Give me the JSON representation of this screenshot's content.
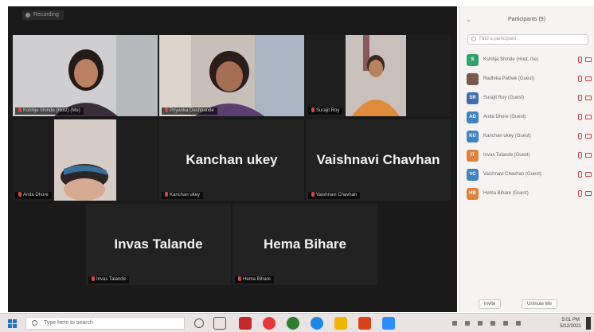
{
  "meeting": {
    "recording_label": "Recording",
    "tiles": [
      {
        "id": "t1",
        "overlay_name": "Kshitija Shinde (Host) (Me)",
        "big_name": ""
      },
      {
        "id": "t2",
        "overlay_name": "Priyanka Deshpande",
        "big_name": ""
      },
      {
        "id": "t3",
        "overlay_name": "Surajit Roy",
        "big_name": ""
      },
      {
        "id": "t4",
        "overlay_name": "Anita Dhore",
        "big_name": ""
      },
      {
        "id": "t5",
        "overlay_name": "Kanchan ukey",
        "big_name": "Kanchan ukey"
      },
      {
        "id": "t6",
        "overlay_name": "Vaishnavi Chavhan",
        "big_name": "Vaishnavi Chavhan"
      },
      {
        "id": "t7",
        "overlay_name": "Invas Talande",
        "big_name": "Invas Talande"
      },
      {
        "id": "t8",
        "overlay_name": "Hema Bihare",
        "big_name": "Hema Bihare"
      }
    ]
  },
  "participants_panel": {
    "title": "Participants (9)",
    "search_placeholder": "Find a participant",
    "items": [
      {
        "initials": "S",
        "color": "#2fa36b",
        "name": "Kshitija Shinde (Host, me)"
      },
      {
        "initials": "",
        "color": "#7a5a48",
        "name": "Radhika Pathak (Guest)"
      },
      {
        "initials": "SR",
        "color": "#3d6fb0",
        "name": "Surajit Roy (Guest)"
      },
      {
        "initials": "AD",
        "color": "#3d84c6",
        "name": "Anita Dhore (Guest)"
      },
      {
        "initials": "KU",
        "color": "#3d84c6",
        "name": "Kanchan ukey (Guest)"
      },
      {
        "initials": "IT",
        "color": "#e0813a",
        "name": "Invas Talande (Guest)"
      },
      {
        "initials": "VC",
        "color": "#3d84c6",
        "name": "Vaishnavi Chavhan (Guest)"
      },
      {
        "initials": "HB",
        "color": "#e0813a",
        "name": "Hema Bihare (Guest)"
      }
    ],
    "invite_label": "Invite",
    "unmute_label": "Unmute Me"
  },
  "taskbar": {
    "search_placeholder": "Type here to search",
    "clock_time": "5:01 PM",
    "clock_date": "5/12/2021"
  }
}
